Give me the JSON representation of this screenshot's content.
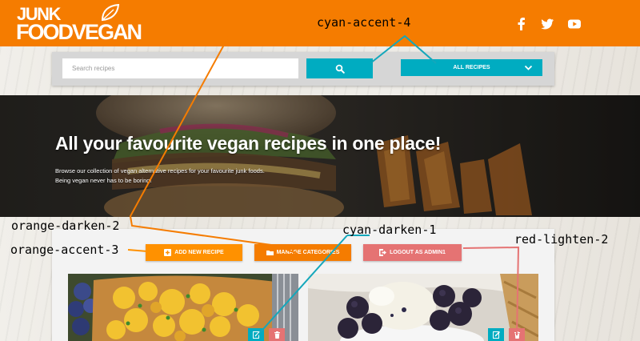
{
  "header": {
    "logo_line1": "JUNK",
    "logo_line2": "FOODVEGAN",
    "social": [
      {
        "icon": "facebook-icon"
      },
      {
        "icon": "twitter-icon"
      },
      {
        "icon": "youtube-icon"
      }
    ]
  },
  "search": {
    "placeholder": "Search recipes",
    "button_icon": "search-icon",
    "filter_label": "ALL RECIPES",
    "filter_icon": "chevron-down-icon"
  },
  "hero": {
    "title": "All your favourite vegan recipes in one place!",
    "subtitle_line1": "Browse our collection of vegan alternative recipes for your favourite junk foods.",
    "subtitle_line2": "Being vegan never has to be boring!"
  },
  "actions": {
    "add_recipe": "ADD NEW RECIPE",
    "manage_categories": "MANAGE CATEGORIES",
    "logout": "LOGOUT AS ADMIN1"
  },
  "cards": [
    {
      "image": "tofu-scramble-toast",
      "edit_icon": "edit-icon",
      "delete_icon": "trash-icon"
    },
    {
      "image": "ice-cream-blackberries",
      "edit_icon": "edit-icon",
      "delete_icon": "trash-icon"
    }
  ],
  "annotations": {
    "cyan_accent_4": "cyan-accent-4",
    "orange_darken_2": "orange-darken-2",
    "orange_accent_3": "orange-accent-3",
    "cyan_darken_1": "cyan-darken-1",
    "red_lighten_2": "red-lighten-2"
  },
  "colors": {
    "header": "#f57c00",
    "cyan_accent": "#00acc1",
    "orange_accent": "#ff9100",
    "orange_darken": "#f57c00",
    "red_lighten": "#e57373"
  }
}
